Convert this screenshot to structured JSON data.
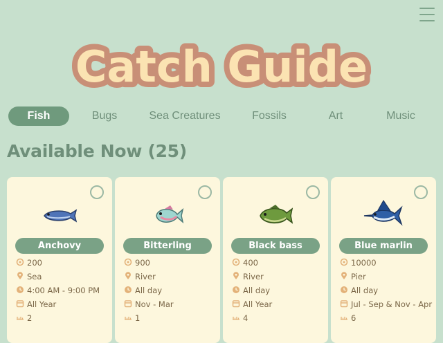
{
  "header": {
    "title": "Catch Guide",
    "menu_icon": "hamburger-menu-icon"
  },
  "tabs": [
    {
      "label": "Fish",
      "active": true
    },
    {
      "label": "Bugs",
      "active": false
    },
    {
      "label": "Sea Creatures",
      "active": false
    },
    {
      "label": "Fossils",
      "active": false
    },
    {
      "label": "Art",
      "active": false
    },
    {
      "label": "Music",
      "active": false
    }
  ],
  "section": {
    "title": "Available Now (25)"
  },
  "colors": {
    "background": "#c7e0cd",
    "accent_green": "#6f9a7d",
    "card_bg": "#fdf7dd",
    "title_fill": "#fbe3b2",
    "title_outline": "#c88f77",
    "detail_text": "#7a6647",
    "detail_icon": "#e3b27a"
  },
  "cards": [
    {
      "name": "Anchovy",
      "price": "200",
      "location": "Sea",
      "time": "4:00 AM - 9:00 PM",
      "season": "All Year",
      "size": "2",
      "icon": "anchovy-icon"
    },
    {
      "name": "Bitterling",
      "price": "900",
      "location": "River",
      "time": "All day",
      "season": "Nov - Mar",
      "size": "1",
      "icon": "bitterling-icon"
    },
    {
      "name": "Black bass",
      "price": "400",
      "location": "River",
      "time": "All day",
      "season": "All Year",
      "size": "4",
      "icon": "black-bass-icon"
    },
    {
      "name": "Blue marlin",
      "price": "10000",
      "location": "Pier",
      "time": "All day",
      "season": "Jul - Sep & Nov - Apr",
      "size": "6",
      "icon": "blue-marlin-icon"
    }
  ]
}
